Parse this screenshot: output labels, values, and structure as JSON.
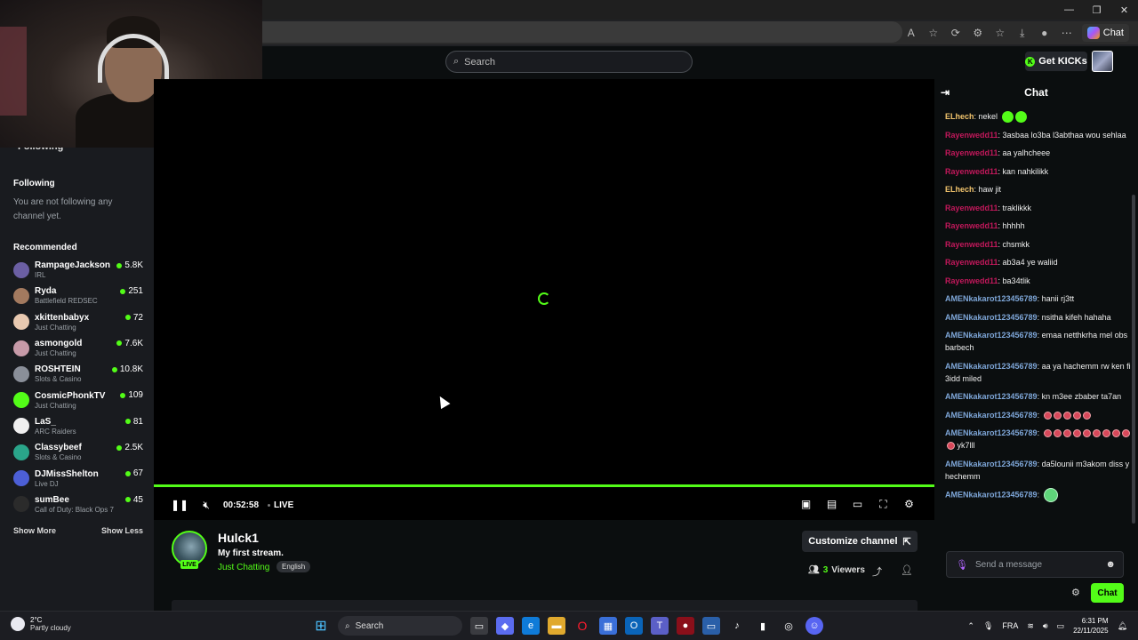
{
  "browser": {
    "toolbar_icons": [
      "read-aloud-icon",
      "favorite-star-icon",
      "extensions-icon",
      "tracking-icon",
      "collections-icon",
      "download-icon",
      "profile-icon",
      "more-icon"
    ],
    "chat_button_label": "Chat"
  },
  "header": {
    "search_placeholder": "Search",
    "get_kicks_label": "Get KICKs"
  },
  "sidebar": {
    "following_top_label": "Following",
    "following_heading": "Following",
    "following_empty": "You are not following any channel yet.",
    "recommended_heading": "Recommended",
    "items": [
      {
        "name": "RampageJackson",
        "category": "IRL",
        "viewers": "5.8K",
        "color": "#6b5fa3"
      },
      {
        "name": "Ryda",
        "category": "Battlefield REDSEC",
        "viewers": "251",
        "color": "#a37a5f"
      },
      {
        "name": "xkittenbabyx",
        "category": "Just Chatting",
        "viewers": "72",
        "color": "#e8c9b0"
      },
      {
        "name": "asmongold",
        "category": "Just Chatting",
        "viewers": "7.6K",
        "color": "#c79aa8"
      },
      {
        "name": "ROSHTEIN",
        "category": "Slots & Casino",
        "viewers": "10.8K",
        "color": "#8a8f99"
      },
      {
        "name": "CosmicPhonkTV",
        "category": "Just Chatting",
        "viewers": "109",
        "color": "#53fc18"
      },
      {
        "name": "LaS_",
        "category": "ARC Raiders",
        "viewers": "81",
        "color": "#f0f0f0"
      },
      {
        "name": "Classybeef",
        "category": "Slots & Casino",
        "viewers": "2.5K",
        "color": "#2aa58a"
      },
      {
        "name": "DJMissShelton",
        "category": "Live DJ",
        "viewers": "67",
        "color": "#4c5fd6"
      },
      {
        "name": "sumBee",
        "category": "Call of Duty: Black Ops 7",
        "viewers": "45",
        "color": "#2b2b2b"
      }
    ],
    "show_more_label": "Show More",
    "show_less_label": "Show Less"
  },
  "player": {
    "elapsed": "00:52:58",
    "live_label": "LIVE",
    "progress_fraction": 1.0
  },
  "channel": {
    "name": "Hulck1",
    "live_badge": "LIVE",
    "stream_title": "My first stream.",
    "category": "Just Chatting",
    "language": "English",
    "customize_label": "Customize channel",
    "viewer_count": "3",
    "viewers_label": "Viewers"
  },
  "chat": {
    "title": "Chat",
    "messages": [
      {
        "user": "ELhech",
        "color": "#f2c46d",
        "text": "nekel",
        "emotes": "gg"
      },
      {
        "user": "Rayenwedd11",
        "color": "#c2185b",
        "text": "3asbaa lo3ba l3abthaa wou sehlaa",
        "emotes": ""
      },
      {
        "user": "Rayenwedd11",
        "color": "#c2185b",
        "text": "aa yalhcheee",
        "emotes": ""
      },
      {
        "user": "Rayenwedd11",
        "color": "#c2185b",
        "text": "kan nahkilikk",
        "emotes": ""
      },
      {
        "user": "ELhech",
        "color": "#f2c46d",
        "text": "haw jit",
        "emotes": ""
      },
      {
        "user": "Rayenwedd11",
        "color": "#c2185b",
        "text": "traklikkk",
        "emotes": ""
      },
      {
        "user": "Rayenwedd11",
        "color": "#c2185b",
        "text": "hhhhh",
        "emotes": ""
      },
      {
        "user": "Rayenwedd11",
        "color": "#c2185b",
        "text": "chsmkk",
        "emotes": ""
      },
      {
        "user": "Rayenwedd11",
        "color": "#c2185b",
        "text": "ab3a4 ye waliid",
        "emotes": ""
      },
      {
        "user": "Rayenwedd11",
        "color": "#c2185b",
        "text": "ba34tlik",
        "emotes": ""
      },
      {
        "user": "AMENkakarot123456789",
        "color": "#7ea6d8",
        "text": "hanii rj3tt",
        "emotes": ""
      },
      {
        "user": "AMENkakarot123456789",
        "color": "#7ea6d8",
        "text": "nsitha kifeh hahaha",
        "emotes": ""
      },
      {
        "user": "AMENkakarot123456789",
        "color": "#7ea6d8",
        "text": "emaa netthkrha mel obs barbech",
        "emotes": ""
      },
      {
        "user": "AMENkakarot123456789",
        "color": "#7ea6d8",
        "text": "aa ya hachemm rw ken fi 3idd miled",
        "emotes": ""
      },
      {
        "user": "AMENkakarot123456789",
        "color": "#7ea6d8",
        "text": "kn m3ee zbaber ta7an",
        "emotes": ""
      },
      {
        "user": "AMENkakarot123456789",
        "color": "#7ea6d8",
        "text": "",
        "emotes": "rrrrr"
      },
      {
        "user": "AMENkakarot123456789",
        "color": "#7ea6d8",
        "text": "yk7lll",
        "emotes": "rrrrrrrrrr"
      },
      {
        "user": "AMENkakarot123456789",
        "color": "#7ea6d8",
        "text": "da5lounii m3akom diss y hechemm",
        "emotes": ""
      },
      {
        "user": "AMENkakarot123456789",
        "color": "#7ea6d8",
        "text": "",
        "emotes": "b"
      }
    ],
    "input_placeholder": "Send a message",
    "send_label": "Chat"
  },
  "taskbar": {
    "temp": "2°C",
    "condition": "Partly cloudy",
    "search_label": "Search",
    "lang": "FRA",
    "time": "6:31 PM",
    "date": "22/11/2025"
  },
  "colors": {
    "accent": "#53fc18",
    "background": "#0b0e0f",
    "sidebar": "#191b1f"
  }
}
